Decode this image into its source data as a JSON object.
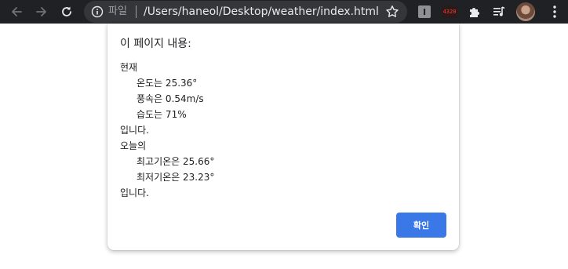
{
  "browser": {
    "scheme_label": "파일",
    "url": "/Users/haneol/Desktop/weather/index.html",
    "extensions": {
      "grey_label": "I",
      "badge_label": "4320"
    },
    "icons": {
      "back": "back-arrow-icon",
      "forward": "forward-arrow-icon",
      "reload": "reload-icon",
      "info": "info-icon",
      "star": "bookmark-star-icon",
      "puzzle": "extensions-puzzle-icon",
      "media": "media-queue-icon",
      "menu": "kebab-menu-icon"
    },
    "colors": {
      "toolbar": "#202124",
      "omnibox": "#35363a",
      "accent": "#3b78e7"
    }
  },
  "dialog": {
    "title": "이 페이지 내용:",
    "lines": [
      "현재",
      "온도는 25.36°",
      "풍속은 0.54m/s",
      "습도는 71%",
      "입니다.",
      "오늘의",
      "최고기온은 25.66°",
      "최저기온은 23.23°",
      "입니다."
    ],
    "ok_label": "확인"
  }
}
